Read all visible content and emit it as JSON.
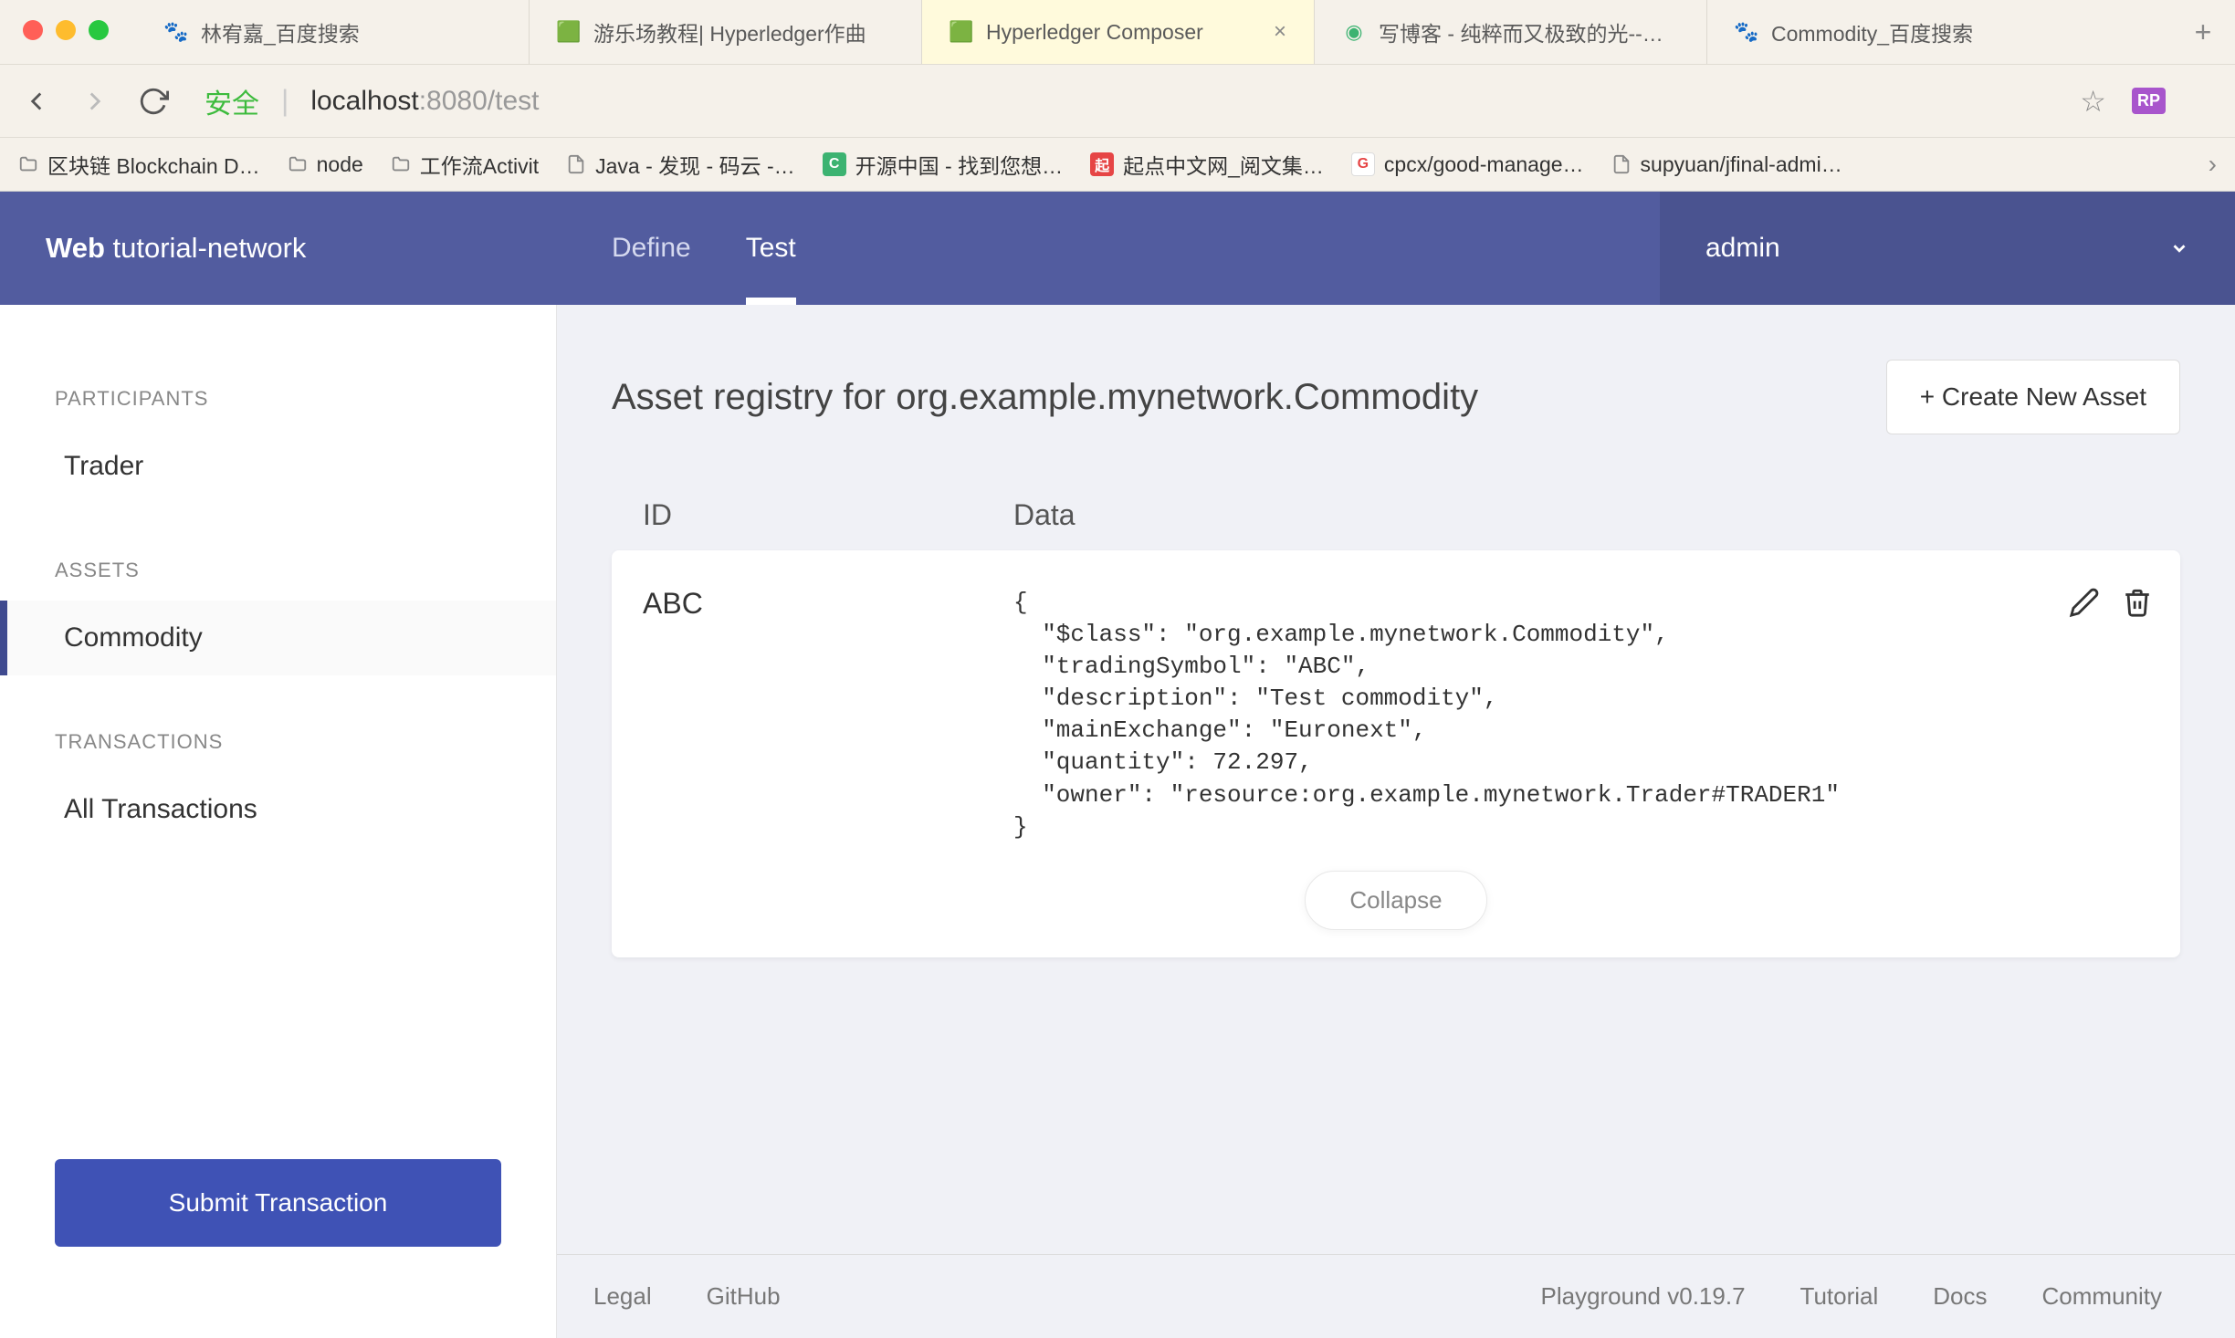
{
  "browser": {
    "tabs": [
      {
        "title": "林宥嘉_百度搜索",
        "active": false
      },
      {
        "title": "游乐场教程| Hyperledger作曲",
        "active": false
      },
      {
        "title": "Hyperledger Composer",
        "active": true
      },
      {
        "title": "写博客 - 纯粹而又极致的光--…",
        "active": false
      },
      {
        "title": "Commodity_百度搜索",
        "active": false
      }
    ],
    "secure_label": "安全",
    "url_host": "localhost",
    "url_path": ":8080/test",
    "bookmarks": [
      {
        "type": "folder",
        "label": "区块链 Blockchain D…"
      },
      {
        "type": "folder",
        "label": "node"
      },
      {
        "type": "folder",
        "label": "工作流Activit"
      },
      {
        "type": "file",
        "label": "Java - 发现 - 码云 -…"
      },
      {
        "type": "site",
        "label": "开源中国 - 找到您想…",
        "icon": "C",
        "bg": "#3cb371"
      },
      {
        "type": "site",
        "label": "起点中文网_阅文集…",
        "icon": "起",
        "bg": "#e64545"
      },
      {
        "type": "site",
        "label": "cpcx/good-manage…",
        "icon": "G",
        "bg": "#fff"
      },
      {
        "type": "file",
        "label": "supyuan/jfinal-admi…"
      }
    ]
  },
  "header": {
    "brand_bold": "Web",
    "brand_rest": " tutorial-network",
    "tabs": {
      "define": "Define",
      "test": "Test"
    },
    "user": "admin"
  },
  "sidebar": {
    "participants_title": "PARTICIPANTS",
    "participants": [
      {
        "label": "Trader"
      }
    ],
    "assets_title": "ASSETS",
    "assets": [
      {
        "label": "Commodity",
        "active": true
      }
    ],
    "transactions_title": "TRANSACTIONS",
    "transactions": [
      {
        "label": "All Transactions"
      }
    ],
    "submit_label": "Submit Transaction"
  },
  "content": {
    "title": "Asset registry for org.example.mynetwork.Commodity",
    "create_label": "+ Create New Asset",
    "columns": {
      "id": "ID",
      "data": "Data"
    },
    "asset": {
      "id": "ABC",
      "json": "{\n  \"$class\": \"org.example.mynetwork.Commodity\",\n  \"tradingSymbol\": \"ABC\",\n  \"description\": \"Test commodity\",\n  \"mainExchange\": \"Euronext\",\n  \"quantity\": 72.297,\n  \"owner\": \"resource:org.example.mynetwork.Trader#TRADER1\"\n}"
    },
    "collapse_label": "Collapse"
  },
  "footer": {
    "legal": "Legal",
    "github": "GitHub",
    "version": "Playground v0.19.7",
    "tutorial": "Tutorial",
    "docs": "Docs",
    "community": "Community"
  }
}
